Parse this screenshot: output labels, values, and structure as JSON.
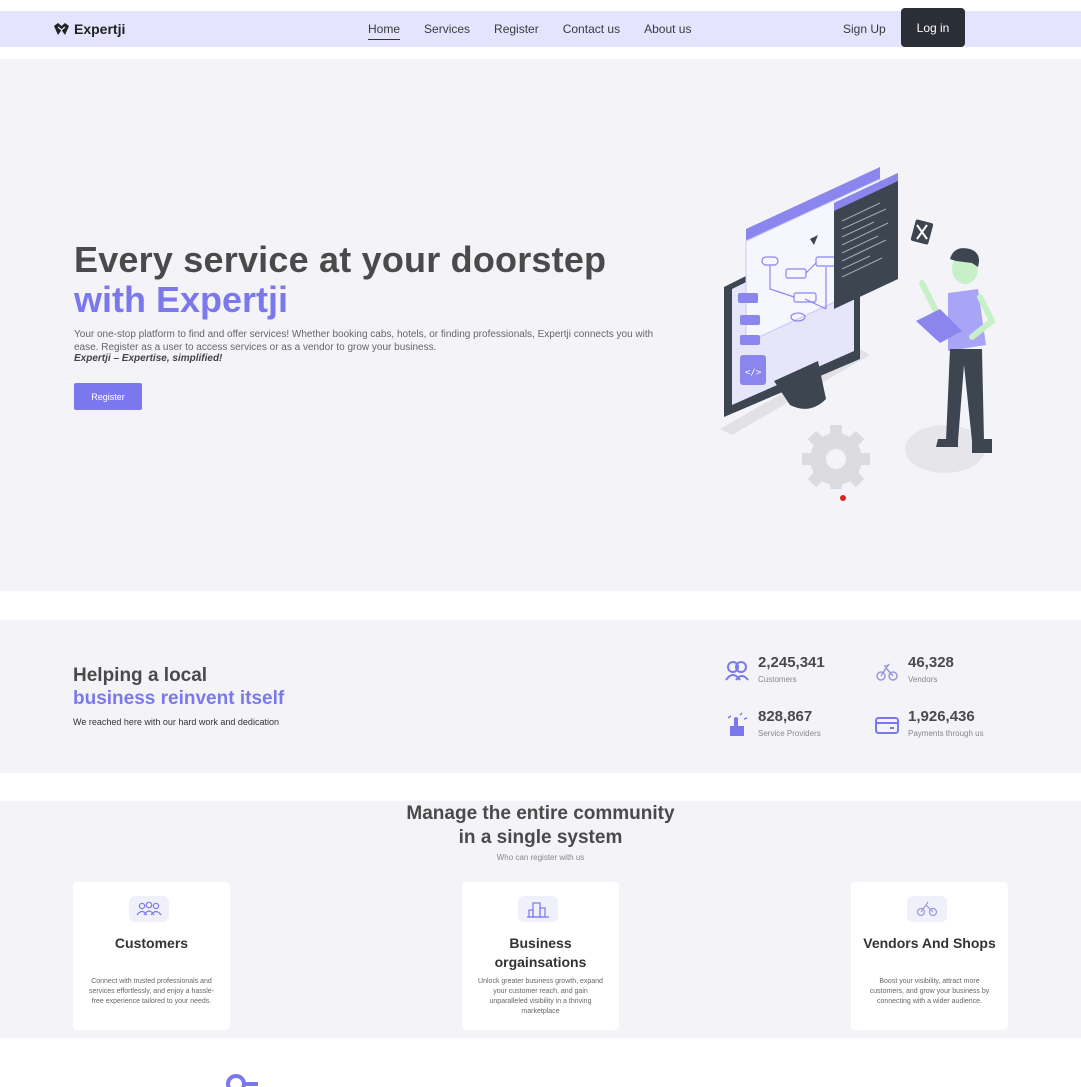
{
  "colors": {
    "accent": "#7b78ee",
    "nav_bg": "#e4e4ff",
    "dark_button": "#2a2e36",
    "section_bg": "#f4f4f8"
  },
  "brand": {
    "name": "Expertji",
    "icon": "handshake-icon"
  },
  "nav": {
    "links": [
      "Home",
      "Services",
      "Register",
      "Contact us",
      "About us"
    ],
    "active": "Home",
    "signup_label": "Sign Up",
    "login_label": "Log in"
  },
  "hero": {
    "title_line1": "Every service at your doorstep",
    "title_line2": "with Expertji",
    "description": "Your one-stop platform to find and offer services! Whether booking cabs, hotels, or finding professionals, Expertji connects you with ease. Register as a user to access services or as a vendor to grow your business.",
    "tagline": "Expertji – Expertise, simplified!",
    "register_label": "Register"
  },
  "stats": {
    "title_line1": "Helping a local",
    "title_line2": "business reinvent itself",
    "subtitle": "We reached here with our hard work and dedication",
    "items": [
      {
        "value": "2,245,341",
        "label": "Customers",
        "icon": "users-icon"
      },
      {
        "value": "46,328",
        "label": "Vendors",
        "icon": "bicycle-icon"
      },
      {
        "value": "828,867",
        "label": "Service Providers",
        "icon": "hand-icon"
      },
      {
        "value": "1,926,436",
        "label": "Payments through us",
        "icon": "card-icon"
      }
    ]
  },
  "community": {
    "title_line1": "Manage the entire community",
    "title_line2": "in a single system",
    "subtitle": "Who can register with us",
    "cards": [
      {
        "title": "Customers",
        "description": "Connect with trusted professionals and services effortlessly, and enjoy a hassle-free experience tailored to your needs.",
        "icon": "group-icon"
      },
      {
        "title": "Business orgainsations",
        "description": "Unlock greater business growth, expand your customer reach, and gain unparalleled visibility in a thriving marketplace",
        "icon": "building-icon"
      },
      {
        "title": "Vendors And Shops",
        "description": "Boost your visibility, attract more customers, and grow your business by connecting with a wider audience.",
        "icon": "bicycle-icon"
      }
    ]
  }
}
